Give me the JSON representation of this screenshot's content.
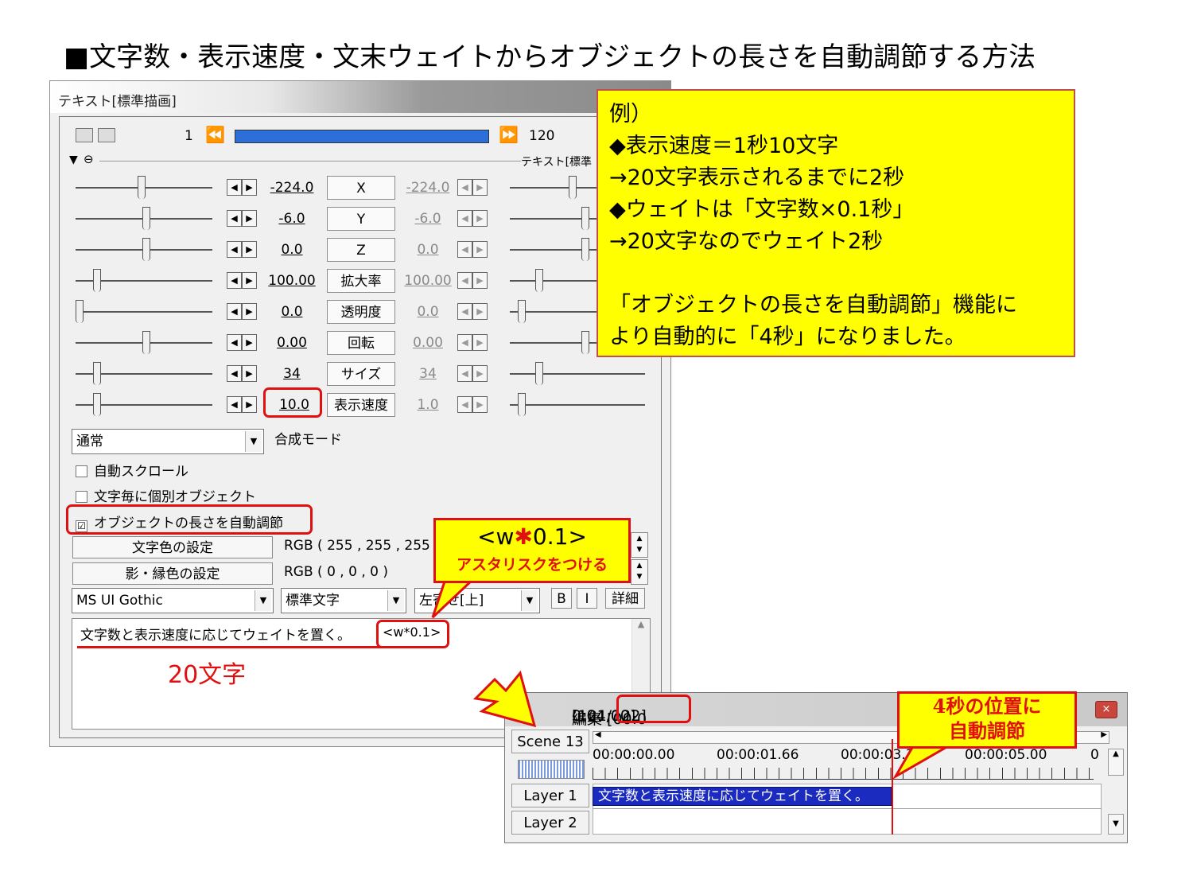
{
  "slide": {
    "title": "■文字数・表示速度・文末ウェイトからオブジェクトの長さを自動調節する方法"
  },
  "text_window": {
    "title": "テキスト[標準描画]",
    "frame_start": "1",
    "frame_end": "120",
    "object_label": "テキスト[標準",
    "params": [
      {
        "value": "-224.0",
        "label": "X",
        "value2": "-224.0"
      },
      {
        "value": "-6.0",
        "label": "Y",
        "value2": "-6.0"
      },
      {
        "value": "0.0",
        "label": "Z",
        "value2": "0.0"
      },
      {
        "value": "100.00",
        "label": "拡大率",
        "value2": "100.00"
      },
      {
        "value": "0.0",
        "label": "透明度",
        "value2": "0.0"
      },
      {
        "value": "0.00",
        "label": "回転",
        "value2": "0.00"
      },
      {
        "value": "34",
        "label": "サイズ",
        "value2": "34"
      },
      {
        "value": "10.0",
        "label": "表示速度",
        "value2": "1.0"
      }
    ],
    "blend_mode_value": "通常",
    "blend_mode_label": "合成モード",
    "checkbox_auto_scroll": "自動スクロール",
    "checkbox_individual": "文字毎に個別オブジェクト",
    "checkbox_auto_length": "オブジェクトの長さを自動調節",
    "checkbox_auto_length_mark": "☑",
    "color_button": "文字色の設定",
    "color_value": "RGB ( 255 , 255 , 255",
    "shadow_button": "影・縁色の設定",
    "shadow_value": "RGB ( 0 , 0 , 0 )",
    "font_value": "MS UI Gothic",
    "style_value": "標準文字",
    "align_value": "左寄せ[上]",
    "bold_label": "B",
    "italic_label": "I",
    "detail_label": "詳細",
    "text_content": "文字数と表示速度に応じてウェイトを置く。",
    "text_tag": "<w*0.1>",
    "char_count_note": "20文字"
  },
  "note": {
    "lines": [
      "例）",
      "◆表示速度＝1秒10文字",
      "→20文字表示されるまでに2秒",
      "◆ウェイトは「文字数×0.1秒」",
      "→20文字なのでウェイト2秒",
      "",
      "「オブジェクトの長さを自動調節」機能に",
      "より自動的に「4秒」になりました。"
    ]
  },
  "callout": {
    "pre": "<w",
    "star": "✱",
    "post": "0.1>",
    "sub": "アスタリスクをつける"
  },
  "timeline": {
    "title_prefix": "編集 [00:0",
    "title_time": "0:04.00]",
    "title_suffix": " [121/122]",
    "close_label": "×",
    "scene": "Scene 13",
    "ruler": [
      "00:00:00.00",
      "00:00:01.66",
      "00:00:03.3",
      "00:00:05.00",
      "0"
    ],
    "layers": [
      "Layer  1",
      "Layer  2"
    ],
    "clip_text": "文字数と表示速度に応じてウェイトを置く。"
  },
  "timeline_note": {
    "line1": "4秒の位置に",
    "line2": "自動調節"
  },
  "colors": {
    "accent_red": "#e01010",
    "note_yellow": "#ffff00",
    "seek_blue": "#2d6fd8",
    "clip_blue": "#1b2bbf"
  }
}
